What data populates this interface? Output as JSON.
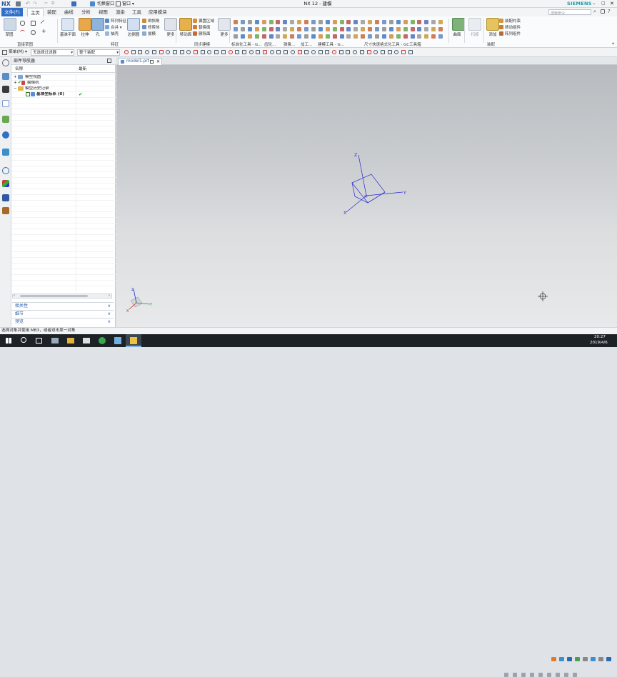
{
  "app": {
    "logo": "NX",
    "title": "NX 12 - 建模",
    "brand": "SIEMENS",
    "search_placeholder": "搜索命令",
    "window_menu": "窗口 ▾",
    "switch_window": "切换窗口"
  },
  "menus": [
    "文件(F)",
    "主页",
    "装配",
    "曲线",
    "分析",
    "视图",
    "渲染",
    "工具",
    "应用模块"
  ],
  "ribbon": {
    "sketch": {
      "label": "草图",
      "group": "直接草图"
    },
    "datum_plane": "基准平面",
    "extrude": "拉伸",
    "hole": "孔",
    "feature_small": [
      "阵列特征",
      "合并 ▾",
      "抽壳"
    ],
    "feature_small2": [
      "倒斜角",
      "修剪体",
      "拔模"
    ],
    "edge_blend": "边倒圆",
    "feature_group": "特征",
    "more1": "更多",
    "move_face": "移动面",
    "sync_small": [
      "偏置区域",
      "替换面",
      "删除面"
    ],
    "sync_group": "同步建模",
    "more2": "更多",
    "group_labels": [
      "标准化工具 - G...",
      "齿轮...",
      "弹簧...",
      "加工...",
      "建模工具 - G...",
      "尺寸快速格式化工具 - GC工具箱"
    ],
    "surface": "曲面",
    "blend": "扫掠",
    "insert_label": "添加",
    "asm_small": [
      "装配约束",
      "移动组件",
      "阵列组件"
    ],
    "asm_group": "装配"
  },
  "cmdbar": {
    "menu": "菜单(M) ▾",
    "filter": "无选择过滤器",
    "scope": "整个装配"
  },
  "navigator": {
    "title": "部件导航器",
    "col_name": "名称",
    "col_latest": "最新",
    "tree": [
      {
        "label": "模型视图",
        "indent": 0
      },
      {
        "label": "摄像机",
        "indent": 0
      },
      {
        "label": "模型历史记录",
        "indent": 0
      },
      {
        "label": "基准坐标系 (0)",
        "indent": 1,
        "latest": "✔"
      }
    ],
    "panels": [
      "相关性",
      "细节",
      "预览"
    ]
  },
  "tabs": [
    {
      "label": "model1.prt"
    }
  ],
  "graphics": {
    "axes": {
      "x": "X",
      "y": "Y",
      "z": "Z"
    }
  },
  "status": {
    "text": "选择对象并使用 MB3，或者双击某一对象"
  },
  "taskbar": {
    "time": "20:27",
    "date": "2019/4/6"
  },
  "colors": {
    "accent": "#2f6fc7",
    "datum": "#2a2ad0",
    "checkmark": "#1a9a1a"
  }
}
